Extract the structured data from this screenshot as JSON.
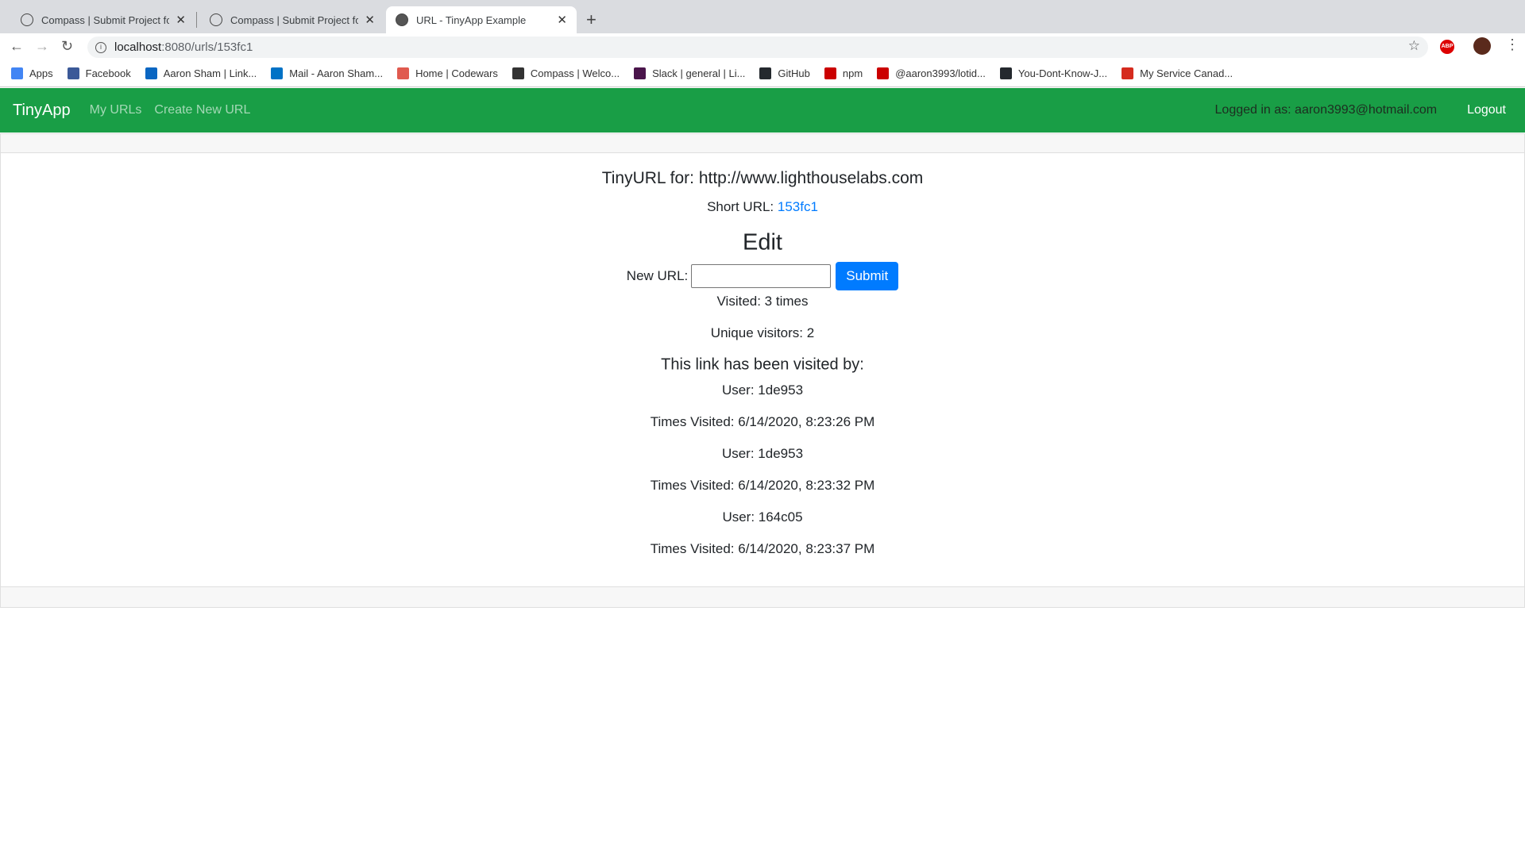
{
  "browser": {
    "tabs": [
      {
        "label": "Compass | Submit Project for E",
        "icon": "compass-icon"
      },
      {
        "label": "Compass | Submit Project for E",
        "icon": "compass-icon"
      },
      {
        "label": "URL - TinyApp Example",
        "icon": "globe-icon",
        "active": true
      }
    ],
    "url_host": "localhost",
    "url_rest": ":8080/urls/153fc1",
    "abp_label": "ABP",
    "bookmarks": [
      {
        "label": "Apps",
        "color": "#4285f4"
      },
      {
        "label": "Facebook",
        "color": "#3b5998"
      },
      {
        "label": "Aaron Sham | Link...",
        "color": "#0a66c2"
      },
      {
        "label": "Mail - Aaron Sham...",
        "color": "#0072c6"
      },
      {
        "label": "Home | Codewars",
        "color": "#e05a4f"
      },
      {
        "label": "Compass | Welco...",
        "color": "#333333"
      },
      {
        "label": "Slack | general | Li...",
        "color": "#4a154b"
      },
      {
        "label": "GitHub",
        "color": "#24292e"
      },
      {
        "label": "npm",
        "color": "#cb0000"
      },
      {
        "label": "@aaron3993/lotid...",
        "color": "#cb0000"
      },
      {
        "label": "You-Dont-Know-J...",
        "color": "#24292e"
      },
      {
        "label": "My Service Canad...",
        "color": "#d52b1e"
      }
    ]
  },
  "navbar": {
    "brand": "TinyApp",
    "links": [
      "My URLs",
      "Create New URL"
    ],
    "logged_in": "Logged in as: aaron3993@hotmail.com",
    "logout": "Logout",
    "color": "#199e46"
  },
  "main": {
    "title": "TinyURL for: http://www.lighthouselabs.com",
    "short_label": "Short URL: ",
    "short_id": "153fc1",
    "edit_heading": "Edit",
    "new_url_label": "New URL:",
    "new_url_value": "",
    "submit": "Submit",
    "visited": "Visited: 3 times",
    "unique": "Unique visitors: 2",
    "visited_by_heading": "This link has been visited by:",
    "visits": [
      {
        "user": "User: 1de953",
        "time": "Times Visited: 6/14/2020, 8:23:26 PM"
      },
      {
        "user": "User: 1de953",
        "time": "Times Visited: 6/14/2020, 8:23:32 PM"
      },
      {
        "user": "User: 164c05",
        "time": "Times Visited: 6/14/2020, 8:23:37 PM"
      }
    ]
  }
}
